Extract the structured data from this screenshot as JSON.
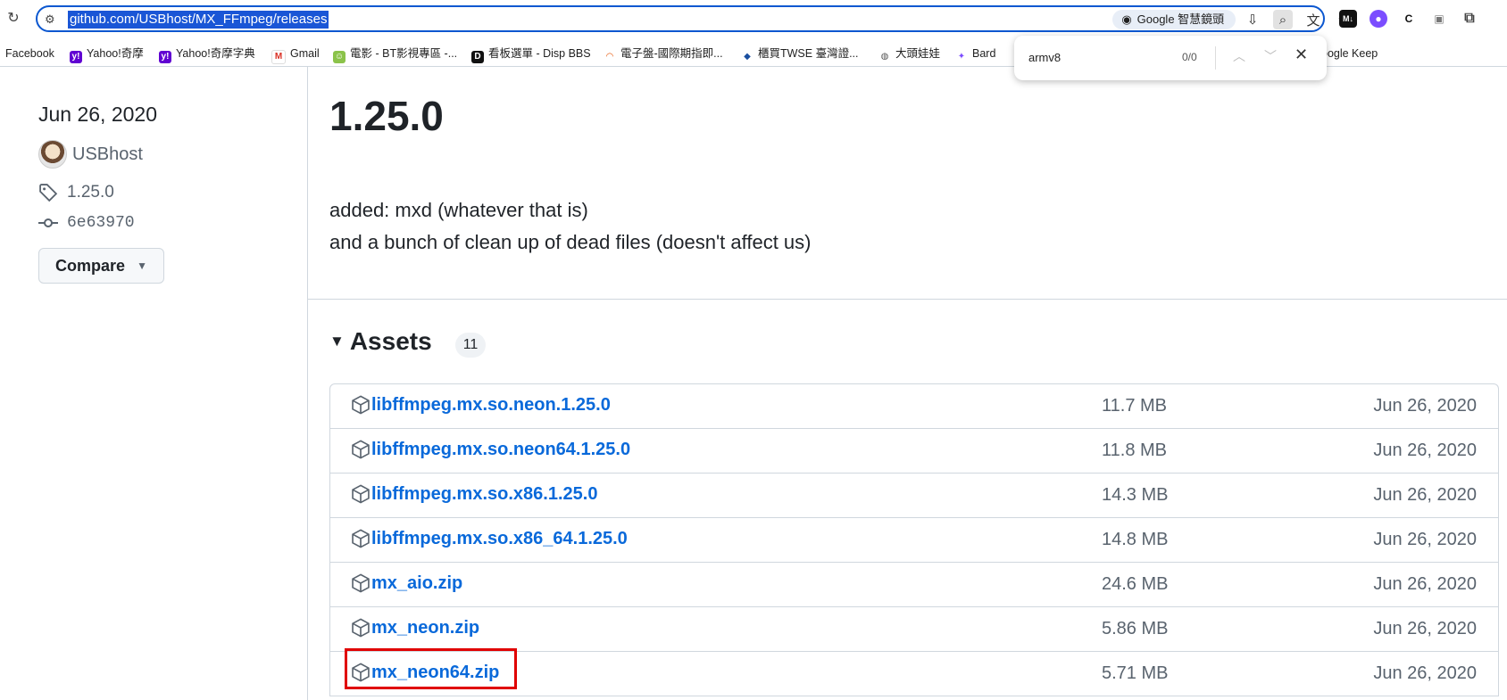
{
  "browser": {
    "url": "github.com/USBhost/MX_FFmpeg/releases",
    "lens_label": "Google 智慧鏡頭",
    "bookmarks": [
      {
        "label": "Facebook"
      },
      {
        "label": "Yahoo!奇摩"
      },
      {
        "label": "Yahoo!奇摩字典"
      },
      {
        "label": "Gmail"
      },
      {
        "label": "電影 - BT影視專區 -..."
      },
      {
        "label": "看板選單 - Disp BBS"
      },
      {
        "label": "電子盤-國際期指即..."
      },
      {
        "label": "櫃買TWSE 臺灣證..."
      },
      {
        "label": "大頭娃娃"
      },
      {
        "label": "Bard"
      },
      {
        "label": "oogle Keep"
      }
    ],
    "find_bar": {
      "query": "armv8",
      "count": "0/0"
    }
  },
  "release": {
    "date": "Jun 26, 2020",
    "author": "USBhost",
    "tag": "1.25.0",
    "commit": "6e63970",
    "compare_label": "Compare",
    "version_title": "1.25.0",
    "notes": [
      "added: mxd (whatever that is)",
      "and a bunch of clean up of dead files (doesn't affect us)"
    ]
  },
  "assets": {
    "heading": "Assets",
    "count": "11",
    "items": [
      {
        "name": "libffmpeg.mx.so.neon.1.25.0",
        "size": "11.7 MB",
        "date": "Jun 26, 2020"
      },
      {
        "name": "libffmpeg.mx.so.neon64.1.25.0",
        "size": "11.8 MB",
        "date": "Jun 26, 2020"
      },
      {
        "name": "libffmpeg.mx.so.x86.1.25.0",
        "size": "14.3 MB",
        "date": "Jun 26, 2020"
      },
      {
        "name": "libffmpeg.mx.so.x86_64.1.25.0",
        "size": "14.8 MB",
        "date": "Jun 26, 2020"
      },
      {
        "name": "mx_aio.zip",
        "size": "24.6 MB",
        "date": "Jun 26, 2020"
      },
      {
        "name": "mx_neon.zip",
        "size": "5.86 MB",
        "date": "Jun 26, 2020"
      },
      {
        "name": "mx_neon64.zip",
        "size": "5.71 MB",
        "date": "Jun 26, 2020"
      }
    ]
  },
  "colors": {
    "link": "#0969da",
    "highlight_box": "#e00000",
    "omnibox_border": "#0b57d0"
  }
}
